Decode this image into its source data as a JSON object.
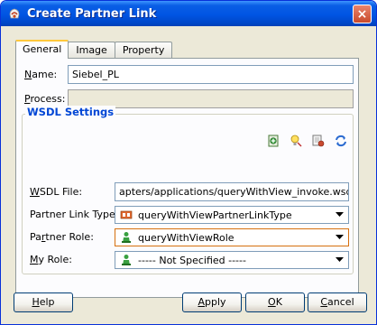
{
  "window": {
    "title": "Create Partner Link",
    "close_label": "×"
  },
  "tabs": [
    {
      "label": "General",
      "active": true
    },
    {
      "label": "Image",
      "active": false
    },
    {
      "label": "Property",
      "active": false
    }
  ],
  "form": {
    "name_label_u": "N",
    "name_label_rest": "ame:",
    "name_value": "Siebel_PL",
    "process_label_u": "P",
    "process_label_rest": "rocess:",
    "process_value": ""
  },
  "wsdl": {
    "group_title": "WSDL Settings",
    "toolbar_icons": [
      "add-wsdl-icon",
      "lightbulb-icon",
      "browse-wsdl-icon",
      "refresh-icon"
    ],
    "file_label_u": "W",
    "file_label_rest": "SDL File:",
    "file_value": "apters/applications/queryWithView_invoke.wsdl?wsdl",
    "link_type_label": "Partner Link Type:",
    "link_type_value": "queryWithViewPartnerLinkType",
    "role_label_pre": "Pa",
    "role_label_u": "r",
    "role_label_post": "tner Role:",
    "role_value": "queryWithViewRole",
    "my_role_label_u": "M",
    "my_role_label_rest": "y Role:",
    "my_role_value": "----- Not Specified -----"
  },
  "buttons": {
    "help_u": "H",
    "help_rest": "elp",
    "apply_pre": "",
    "apply_u": "A",
    "apply_rest": "pply",
    "ok_u": "O",
    "ok_rest": "K",
    "cancel_pre": "",
    "cancel_u": "C",
    "cancel_rest": "ancel"
  },
  "colors": {
    "titlebar": "#0054e3",
    "group_title": "#0046d5",
    "tab_active_accent": "#ffc83c"
  }
}
